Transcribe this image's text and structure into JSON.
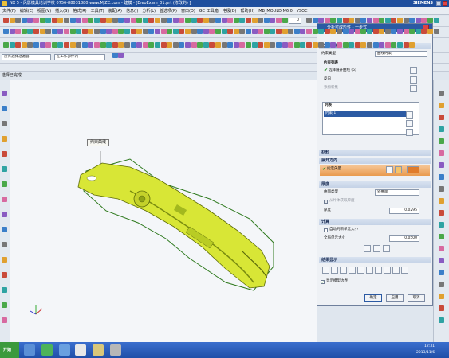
{
  "titlebar": {
    "title": "NX 5 - 风影模具培训学校  0756-88031880  www.MJZC.com - 建模 - [EreoExam_01.prt (修改的) ]",
    "brand": "SIEMENS"
  },
  "menu": [
    "文件(F)",
    "编辑(E)",
    "视图(V)",
    "插入(S)",
    "格式(R)",
    "工具(T)",
    "装配(A)",
    "信息(I)",
    "分析(L)",
    "首选项(P)",
    "窗口(O)",
    "GC 工具箱",
    "电极(D)",
    "帮助(H)",
    "MB_MOULD M6.0",
    "YSOC"
  ],
  "toolbar": {
    "filter_select": "没有选择过滤器",
    "scope_select": "在工作部件内",
    "zoom_value": "0"
  },
  "viewport": {
    "status_text": "选择已完成",
    "callout": "约束曲线"
  },
  "dialog": {
    "title": "分析可成形性 - 一步式",
    "sec_boundary": "边界条件",
    "constraint_type_label": "约束类型",
    "constraint_type_value": "曲线约束",
    "constraint_list_label": "约束列表",
    "select_curve_label": "选择展开曲线 (5)",
    "reverse_label": "反向",
    "add_new_label": "添加新集",
    "list_header": "列表",
    "list_item": "约束 1",
    "sec_material": "材料",
    "sec_direction": "展开方向",
    "specify_vector_label": "指定矢量",
    "sec_thickness": "厚度",
    "surface_type_label": "曲面类型",
    "surface_type_value": "外曲面",
    "from_model_label": "从片体获取厚度",
    "thickness_label": "厚度",
    "thickness_value": "0.0295",
    "sec_compute": "计算",
    "auto_mesh_label": "自动判断单元大小",
    "element_size_label": "全局单元大小",
    "element_size_value": "0.0500",
    "sec_preview": "结果显示",
    "show_boundary_label": "显示模型边界",
    "ok_label": "确定",
    "apply_label": "应用",
    "cancel_label": "取消"
  },
  "taskbar": {
    "start_label": "开始",
    "time": "12:31",
    "date": "2013/11/6"
  },
  "colors": {
    "part": "#d8e636",
    "part_edge": "#5c6b0a",
    "boundary": "#2f7a1f",
    "title_blue": "#2b5aa3"
  }
}
